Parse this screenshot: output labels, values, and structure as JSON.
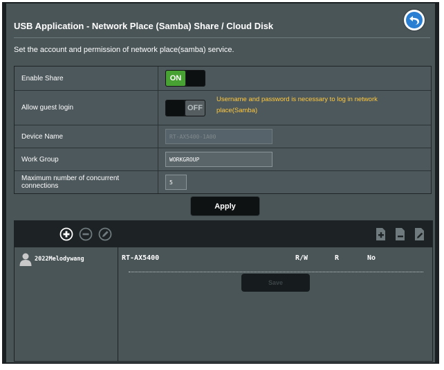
{
  "header": {
    "title": "USB Application - Network Place (Samba) Share / Cloud Disk",
    "description": "Set the account and permission of network place(samba) service."
  },
  "form": {
    "enable_share": {
      "label": "Enable Share",
      "state": "ON"
    },
    "guest_login": {
      "label": "Allow guest login",
      "state": "OFF",
      "hint": "Username and password is necessary to log in network place(Samba)"
    },
    "device_name": {
      "label": "Device Name",
      "value": "RT-AX5400-1A00"
    },
    "work_group": {
      "label": "Work Group",
      "value": "WORKGROUP"
    },
    "max_connections": {
      "label": "Maximum number of concurrent connections",
      "value": "5"
    }
  },
  "apply_label": "Apply",
  "accounts": {
    "users": [
      {
        "name": "2022Melodywang"
      }
    ],
    "share": {
      "name": "RT-AX5400",
      "permissions": [
        "R/W",
        "R",
        "No"
      ]
    },
    "save_label": "Save"
  },
  "icons": {
    "back": "back-arrow-icon",
    "add_user": "add-icon",
    "remove_user": "remove-icon",
    "edit_user": "edit-icon",
    "add_folder": "add-folder-icon",
    "delete_folder": "delete-folder-icon",
    "rename_folder": "rename-folder-icon",
    "user": "user-icon"
  },
  "colors": {
    "accent_on": "#47a233",
    "hint_text": "#ffc93f",
    "back_button": "#2b7fd3"
  }
}
